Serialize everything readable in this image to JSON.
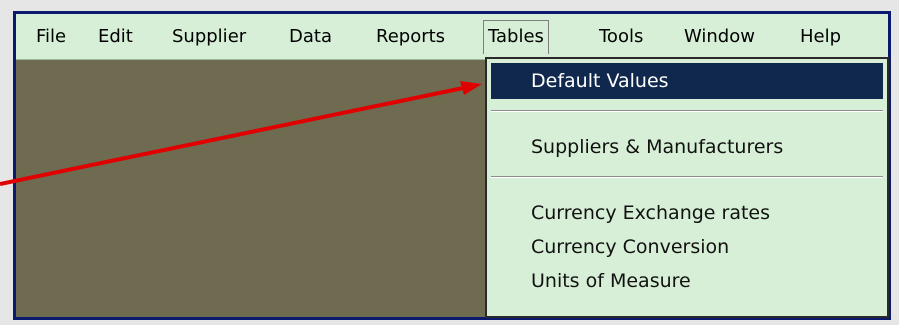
{
  "menubar": {
    "items": [
      {
        "label": "File"
      },
      {
        "label": "Edit"
      },
      {
        "label": "Supplier"
      },
      {
        "label": "Data"
      },
      {
        "label": "Reports"
      },
      {
        "label": "Tables"
      },
      {
        "label": "Tools"
      },
      {
        "label": "Window"
      },
      {
        "label": "Help"
      }
    ],
    "active": "Tables"
  },
  "dropdown": {
    "items": [
      {
        "label": "Default Values"
      },
      {
        "label": "Suppliers & Manufacturers"
      },
      {
        "label": "Currency Exchange rates"
      },
      {
        "label": "Currency Conversion"
      },
      {
        "label": "Units of Measure"
      }
    ],
    "selected": "Default Values"
  },
  "colors": {
    "menubar_bg": "#d6efd6",
    "workspace_bg": "#6e6b50",
    "frame_border": "#0a1a6e",
    "selection_bg": "#10284e",
    "annotation_arrow": "#e00000"
  }
}
